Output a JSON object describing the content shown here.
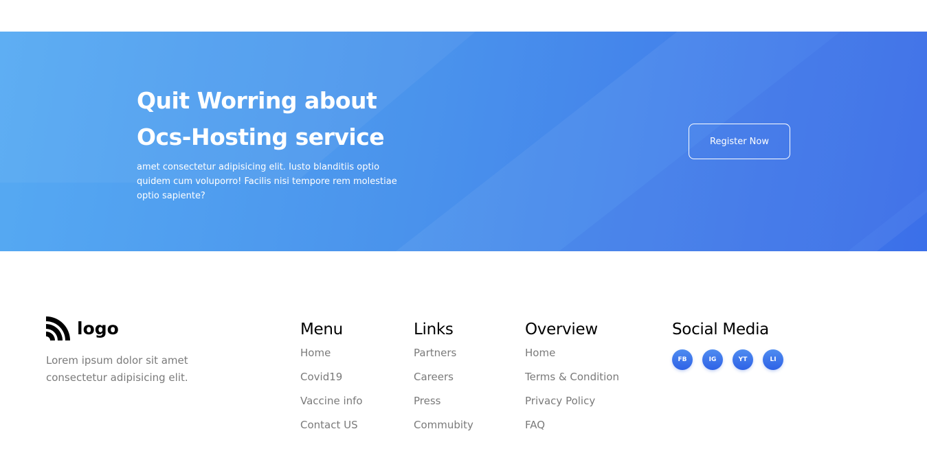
{
  "cta": {
    "title_line1": "Quit Worring about",
    "title_line2": "Ocs-Hosting service",
    "description": "amet consectetur adipisicing elit. Iusto blanditiis optio quidem cum voluporro! Facilis nisi tempore rem molestiae optio sapiente?",
    "button_label": "Register Now"
  },
  "brand": {
    "logo_text": "logo",
    "description": "Lorem ipsum dolor sit amet consectetur adipisicing elit."
  },
  "footer": {
    "menu": {
      "heading": "Menu",
      "items": [
        "Home",
        "Covid19",
        "Vaccine info",
        "Contact US"
      ]
    },
    "links": {
      "heading": "Links",
      "items": [
        "Partners",
        "Careers",
        "Press",
        "Commubity"
      ]
    },
    "overview": {
      "heading": "Overview",
      "items": [
        "Home",
        "Terms & Condition",
        "Privacy Policy",
        "FAQ"
      ]
    },
    "social": {
      "heading": "Social Media",
      "items": [
        "FB",
        "IG",
        "YT",
        "LI"
      ]
    }
  },
  "colors": {
    "accent": "#3b6fe9",
    "gradient_start": "#56aaf3",
    "muted_text": "#7a7a7a"
  },
  "icons": {
    "logo": "rss-wave-icon"
  }
}
